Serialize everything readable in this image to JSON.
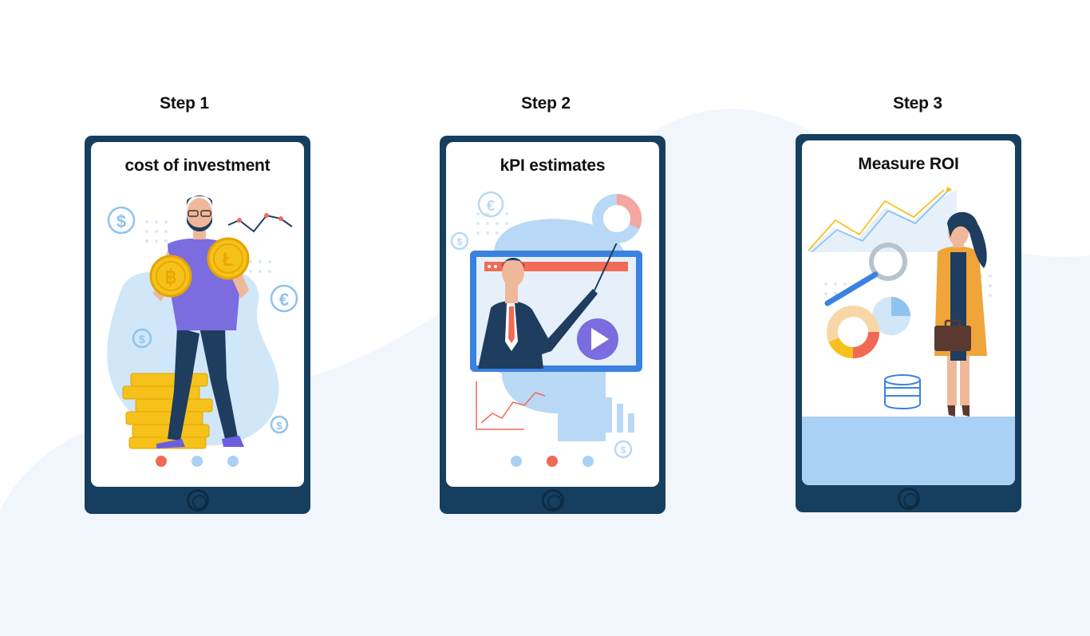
{
  "colors": {
    "tablet_frame": "#163f5f",
    "screen": "#ffffff",
    "background_blob": "#f1f6fd",
    "dot_active": "#f16a55",
    "dot_inactive": "#a9d0f5"
  },
  "steps": [
    {
      "label": "Step 1",
      "title": "cost of investment",
      "illustration": "man-holding-crypto-coins",
      "dots": [
        "active",
        "inactive",
        "inactive"
      ]
    },
    {
      "label": "Step 2",
      "title": "kPI estimates",
      "illustration": "presenter-with-video-screen",
      "dots": [
        "inactive",
        "active",
        "inactive"
      ]
    },
    {
      "label": "Step 3",
      "title": "Measure ROI",
      "illustration": "woman-with-briefcase-and-charts",
      "dots": []
    }
  ]
}
